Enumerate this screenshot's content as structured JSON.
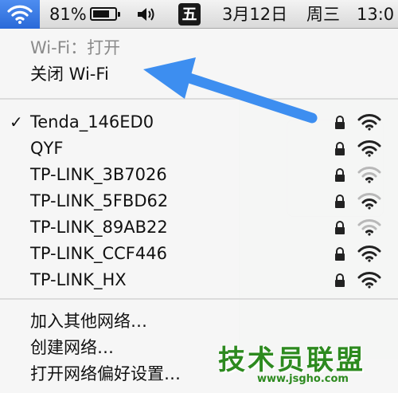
{
  "menubar": {
    "battery_percent_label": "81%",
    "battery_level": 0.81,
    "ime_label": "五",
    "date": "3月12日",
    "weekday": "周三",
    "time": "13:0"
  },
  "menu": {
    "wifi_status": "Wi-Fi：打开",
    "toggle_wifi": "关闭 Wi-Fi",
    "networks": [
      {
        "name": "Tenda_146ED0",
        "connected": true,
        "locked": true,
        "signal": 3
      },
      {
        "name": "QYF",
        "connected": false,
        "locked": true,
        "signal": 3
      },
      {
        "name": "TP-LINK_3B7026",
        "connected": false,
        "locked": true,
        "signal": 1
      },
      {
        "name": "TP-LINK_5FBD62",
        "connected": false,
        "locked": true,
        "signal": 2
      },
      {
        "name": "TP-LINK_89AB22",
        "connected": false,
        "locked": true,
        "signal": 1
      },
      {
        "name": "TP-LINK_CCF446",
        "connected": false,
        "locked": true,
        "signal": 3
      },
      {
        "name": "TP-LINK_HX",
        "connected": false,
        "locked": true,
        "signal": 3
      }
    ],
    "actions": {
      "join_other": "加入其他网络…",
      "create_network": "创建网络…",
      "open_prefs": "打开网络偏好设置…"
    },
    "check_mark": "✓"
  },
  "watermark": {
    "brand": "技术员联盟",
    "url": "www.jsgho.com"
  },
  "colors": {
    "menubar_highlight": "#3b7be6",
    "arrow": "#3d8ef0",
    "signal_strong": "#222222",
    "signal_weak": "#b8b8b8",
    "watermark": "#2d8a1f"
  }
}
